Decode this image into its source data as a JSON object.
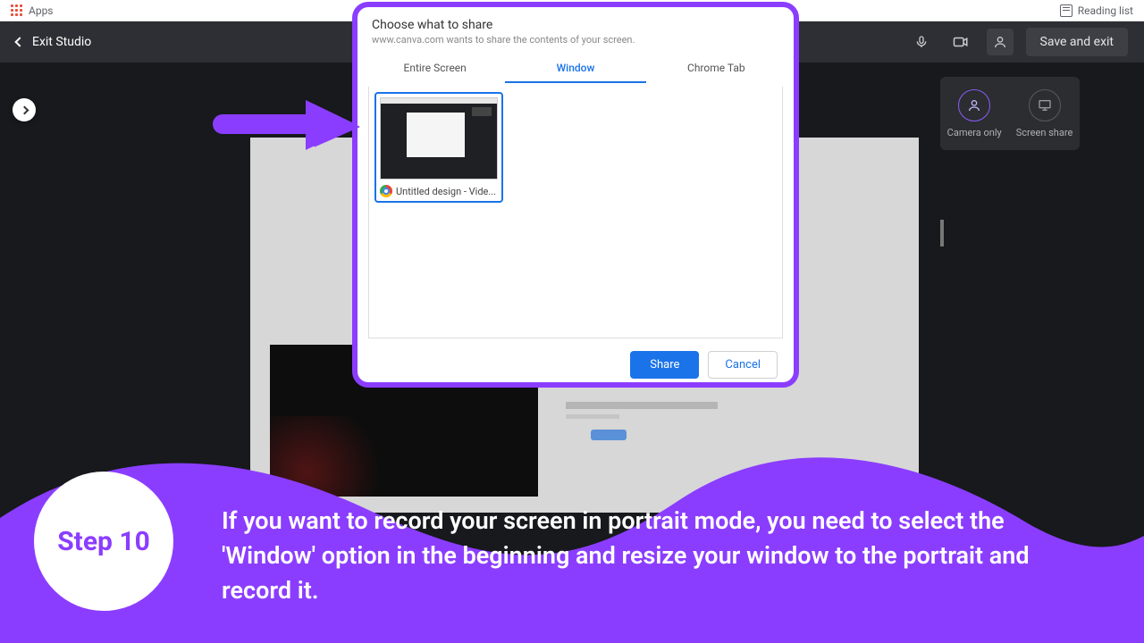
{
  "chrome": {
    "apps": "Apps",
    "reading_list": "Reading list"
  },
  "header": {
    "exit": "Exit Studio",
    "save_exit": "Save and exit"
  },
  "rec_panel": {
    "camera_only": "Camera only",
    "screen_share": "Screen share"
  },
  "dialog": {
    "title": "Choose what to share",
    "subtitle": "www.canva.com wants to share the contents of your screen.",
    "tabs": {
      "entire": "Entire Screen",
      "window": "Window",
      "chrome": "Chrome Tab"
    },
    "thumb_label": "Untitled design - Vide...",
    "share": "Share",
    "cancel": "Cancel"
  },
  "step": {
    "label": "Step 10",
    "text": "If you want to record your screen in portrait mode, you need to select the 'Window' option in the beginning and resize your window to the portrait and record it."
  }
}
